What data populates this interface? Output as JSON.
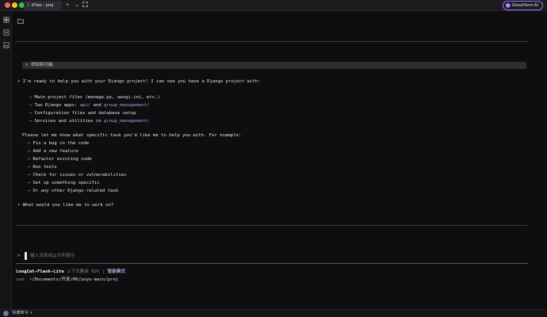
{
  "window": {
    "tab_index": "1",
    "tab_title": "iFlow - proj",
    "new_tab_icon": "plus-icon",
    "dropdown_icon": "chevron-down-icon",
    "fullscreen_icon": "expand-icon",
    "brand_label": "GhostTerm AI"
  },
  "sidebar": {
    "icons": [
      "layout-icon",
      "list-icon",
      "image-icon"
    ]
  },
  "terminal": {
    "command": "> 添加新功能",
    "lines": [
      {
        "segments": [
          {
            "text": "• I'm ready to help you with your Django project! I can see you have a Django project with:"
          }
        ]
      },
      {
        "segments": [
          {
            "text": "  – Main project files (manage.py, uwsgi.ini, etc.)"
          }
        ]
      },
      {
        "segments": [
          {
            "text": "  – Two Django apps: "
          },
          {
            "text": "api/",
            "accent": true
          },
          {
            "text": " and "
          },
          {
            "text": "group_management/",
            "accent": true
          }
        ]
      },
      {
        "segments": [
          {
            "text": "  – Configuration files and database setup"
          }
        ]
      },
      {
        "segments": [
          {
            "text": "  – Services and utilities in "
          },
          {
            "text": "group_management/",
            "accent": true
          }
        ]
      },
      {
        "segments": [
          {
            "text": "Please let me know what specific task you'd like me to help you with. For example:"
          }
        ]
      },
      {
        "segments": [
          {
            "text": "  – Fix a bug in the code"
          }
        ]
      },
      {
        "segments": [
          {
            "text": "  – Add a new feature"
          }
        ]
      },
      {
        "segments": [
          {
            "text": "  – Refactor existing code"
          }
        ]
      },
      {
        "segments": [
          {
            "text": "  – Run tests"
          }
        ]
      },
      {
        "segments": [
          {
            "text": "  – Check for issues or vulnerabilities"
          }
        ]
      },
      {
        "segments": [
          {
            "text": "  – Set up something specific"
          }
        ]
      },
      {
        "segments": [
          {
            "text": "  – Or any other Django-related task"
          }
        ]
      },
      {
        "segments": [
          {
            "text": "• What would you like me to work on?"
          }
        ]
      }
    ]
  },
  "input": {
    "prompt": ">",
    "placeholder": "输入消息或@文件路径"
  },
  "status": {
    "model": "LongCat-Flash-Lite",
    "context_label": "上下文剩余 82%",
    "separator": "|",
    "mode": "智能模式",
    "cwd_label": "cwd:",
    "cwd_path": "~/Documents/开发/HK/yoyo-main/proj"
  },
  "bottombar": {
    "label": "快捷命令",
    "chevron": "▾"
  },
  "colors": {
    "accent": "#b39ddb",
    "background": "#0e0e10",
    "command_bar": "#2e2e31"
  }
}
